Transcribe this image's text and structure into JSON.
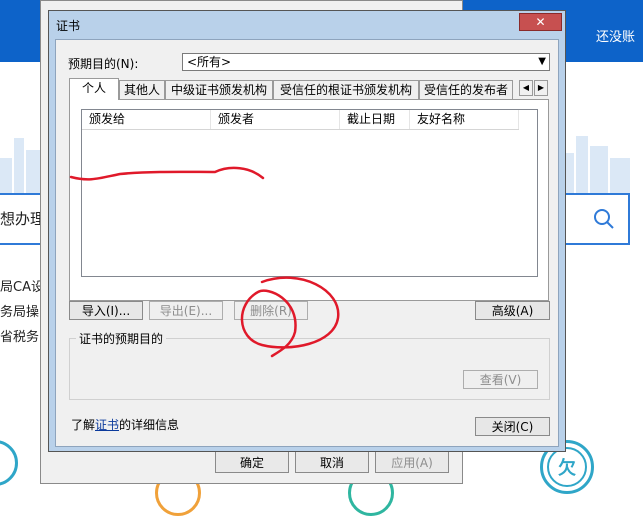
{
  "background": {
    "header_right_text": "还没账",
    "search_text": "想办理",
    "list_items": [
      "局CA设",
      "务局操",
      "省税务"
    ],
    "bottom_circle_glyph": "欠"
  },
  "back_dialog": {
    "buttons": [
      "确定",
      "取消",
      "应用(A)"
    ]
  },
  "dialog": {
    "title": "证书",
    "close_glyph": "✕",
    "purpose_label": "预期目的(N):",
    "purpose_value": "<所有>",
    "tabs": [
      "个人",
      "其他人",
      "中级证书颁发机构",
      "受信任的根证书颁发机构",
      "受信任的发布者"
    ],
    "tab_scroll_left": "◀",
    "tab_scroll_right": "▶",
    "columns": [
      "颁发给",
      "颁发者",
      "截止日期",
      "友好名称"
    ],
    "buttons": {
      "import": "导入(I)...",
      "export": "导出(E)...",
      "remove": "删除(R)",
      "advanced": "高级(A)",
      "view": "查看(V)",
      "close": "关闭(C)"
    },
    "group_title": "证书的预期目的",
    "learn_more_prefix": "了解",
    "learn_more_link": "证书",
    "learn_more_suffix": "的详细信息"
  },
  "colors": {
    "header_blue": "#0d63c9",
    "annotation_red": "#e0192a",
    "title_bar": "#b9d1ea"
  }
}
